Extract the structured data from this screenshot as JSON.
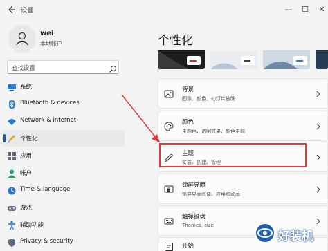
{
  "window": {
    "title": "设置"
  },
  "profile": {
    "name": "wei",
    "account_type": "本地帐户"
  },
  "search": {
    "placeholder": "查找设置"
  },
  "sidebar": {
    "items": [
      {
        "label": "系统",
        "icon": "monitor-icon"
      },
      {
        "label": "Bluetooth & devices",
        "icon": "bluetooth-icon"
      },
      {
        "label": "Network & internet",
        "icon": "wifi-icon"
      },
      {
        "label": "个性化",
        "icon": "brush-icon",
        "active": true
      },
      {
        "label": "应用",
        "icon": "apps-icon"
      },
      {
        "label": "帐户",
        "icon": "person-icon"
      },
      {
        "label": "Time & language",
        "icon": "globe-clock-icon"
      },
      {
        "label": "游戏",
        "icon": "gamepad-icon"
      },
      {
        "label": "辅助功能",
        "icon": "accessibility-icon"
      },
      {
        "label": "Privacy & security",
        "icon": "shield-icon"
      }
    ]
  },
  "main": {
    "title": "个性化",
    "cards": [
      {
        "title": "背景",
        "subtitle": "图像、颜色、幻灯片放映",
        "icon": "image-icon"
      },
      {
        "title": "颜色",
        "subtitle": "主题色、透明效果、颜色主题",
        "icon": "palette-icon"
      },
      {
        "title": "主题",
        "subtitle": "安装、创建、管理",
        "icon": "pen-icon"
      },
      {
        "title": "锁屏界面",
        "subtitle": "锁屏界面图像、应用和动画",
        "icon": "lock-screen-icon"
      },
      {
        "title": "触摸键盘",
        "subtitle": "Themes, size",
        "icon": "keyboard-icon"
      },
      {
        "title": "开始",
        "subtitle": "",
        "icon": "start-icon"
      }
    ]
  },
  "watermark": {
    "text": "好装机"
  },
  "colors": {
    "accent": "#0067c0",
    "highlight": "#e03a3a"
  }
}
